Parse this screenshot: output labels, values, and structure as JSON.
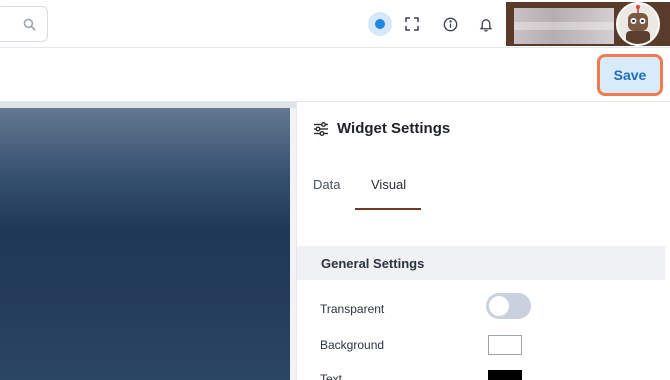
{
  "header": {
    "search_icon": "search-icon",
    "status_color": "#1e88e5",
    "icons": [
      "fullscreen-icon",
      "info-icon",
      "bell-icon"
    ]
  },
  "toolbar": {
    "save_label": "Save"
  },
  "panel": {
    "title": "Widget Settings",
    "tabs": [
      {
        "label": "Data",
        "active": false
      },
      {
        "label": "Visual",
        "active": true
      }
    ],
    "section_title": "General Settings",
    "settings": {
      "transparent_label": "Transparent",
      "transparent_on": false,
      "background_label": "Background",
      "background_color": "#ffffff",
      "text_label": "Text",
      "text_color": "#000000"
    }
  },
  "colors": {
    "accent": "#1f6fb8",
    "save_outline": "#f07b51",
    "tab_underline": "#6b3e22"
  }
}
